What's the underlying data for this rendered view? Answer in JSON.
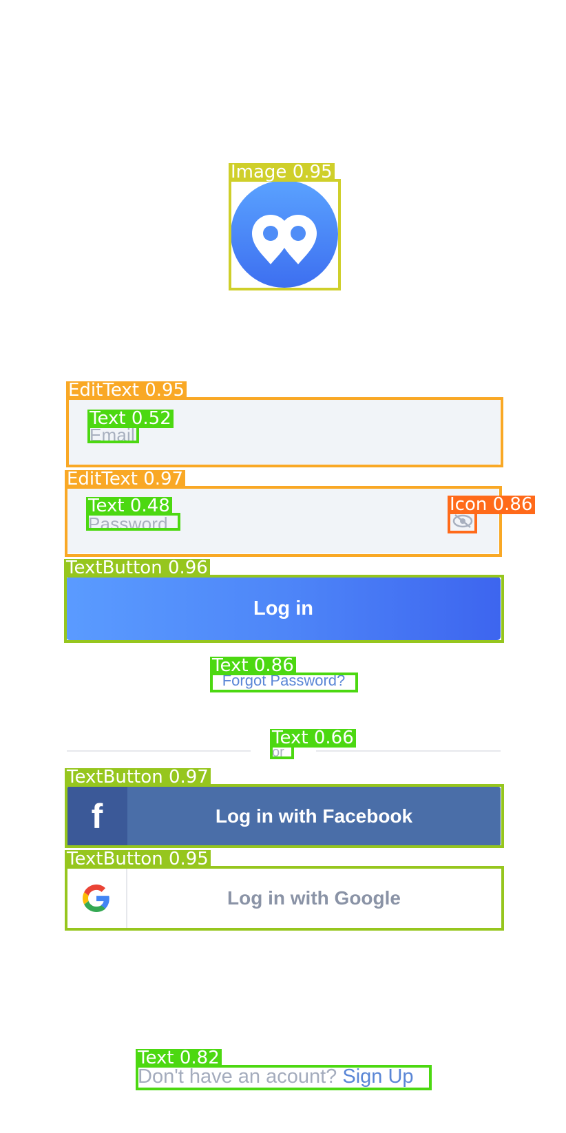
{
  "logo": {
    "icon": "location-pins-icon",
    "colors": [
      "#5aa2ff",
      "#3d6ff0"
    ]
  },
  "login_form": {
    "email_placeholder": "Email",
    "password_placeholder": "Password",
    "password_toggle_icon": "eye-off-icon",
    "login_button": "Log in",
    "forgot_password": "Forgot Password?"
  },
  "divider": {
    "label": "or"
  },
  "social": {
    "facebook": {
      "icon": "facebook-icon",
      "label": "Log in with Facebook",
      "color": "#4a6ea8"
    },
    "google": {
      "icon": "google-icon",
      "label": "Log in with Google"
    }
  },
  "footer": {
    "prompt": "Don't have an acount?",
    "link": "Sign Up"
  },
  "detections": {
    "image_logo": "Image 0.95",
    "edit_email": "EditText 0.95",
    "text_email": "Text 0.52",
    "edit_password": "EditText 0.97",
    "text_password": "Text 0.48",
    "icon_eye": "Icon 0.86",
    "btn_login": "TextButton 0.96",
    "text_forgot": "Text 0.86",
    "text_or": "Text 0.66",
    "btn_facebook": "TextButton 0.97",
    "btn_google": "TextButton 0.95",
    "text_signup": "Text 0.82"
  }
}
